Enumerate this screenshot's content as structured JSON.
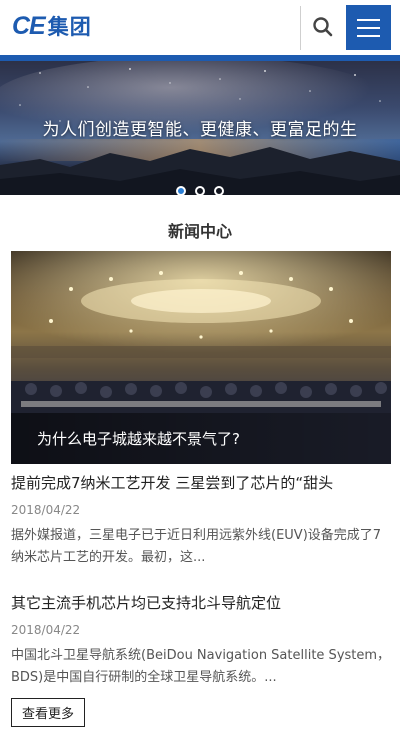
{
  "header": {
    "logo_latin": "CE",
    "logo_chinese": "集团",
    "search_icon": "search-icon",
    "menu_icon": "hamburger-menu-icon",
    "accent": "#1d5bb0"
  },
  "banner": {
    "slogan": "为人们创造更智能、更健康、更富足的生",
    "slide_count": 3,
    "active_slide": 1
  },
  "news": {
    "section_title": "新闻中心",
    "feature_caption": "为什么电子城越来越不景气了?",
    "items": [
      {
        "title": "提前完成7纳米工艺开发 三星尝到了芯片的“甜头",
        "date": "2018/04/22",
        "desc": "据外媒报道，三星电子已于近日利用远紫外线(EUV)设备完成了7纳米芯片工艺的开发。最初，这..."
      },
      {
        "title": "其它主流手机芯片均已支持北斗导航定位",
        "date": "2018/04/22",
        "desc": "中国北斗卫星导航系统(BeiDou Navigation Satellite System，BDS)是中国自行研制的全球卫星导航系统。..."
      }
    ],
    "more_label": "查看更多"
  }
}
